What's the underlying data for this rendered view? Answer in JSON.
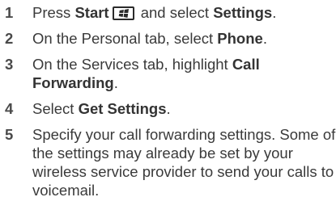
{
  "steps": [
    {
      "number": "1",
      "parts": [
        "Press ",
        "Start",
        " and select ",
        "Settings",
        "."
      ],
      "key_icon": "windows-start-key-icon"
    },
    {
      "number": "2",
      "parts": [
        "On the Personal tab, select ",
        "Phone",
        "."
      ]
    },
    {
      "number": "3",
      "parts": [
        "On the Services tab, highlight ",
        "Call Forwarding",
        "."
      ]
    },
    {
      "number": "4",
      "parts": [
        "Select ",
        "Get Settings",
        "."
      ]
    },
    {
      "number": "5",
      "parts": [
        "Specify your call forwarding settings. Some of the settings may already be set by your wireless service provider to send your calls to voicemail."
      ]
    }
  ]
}
